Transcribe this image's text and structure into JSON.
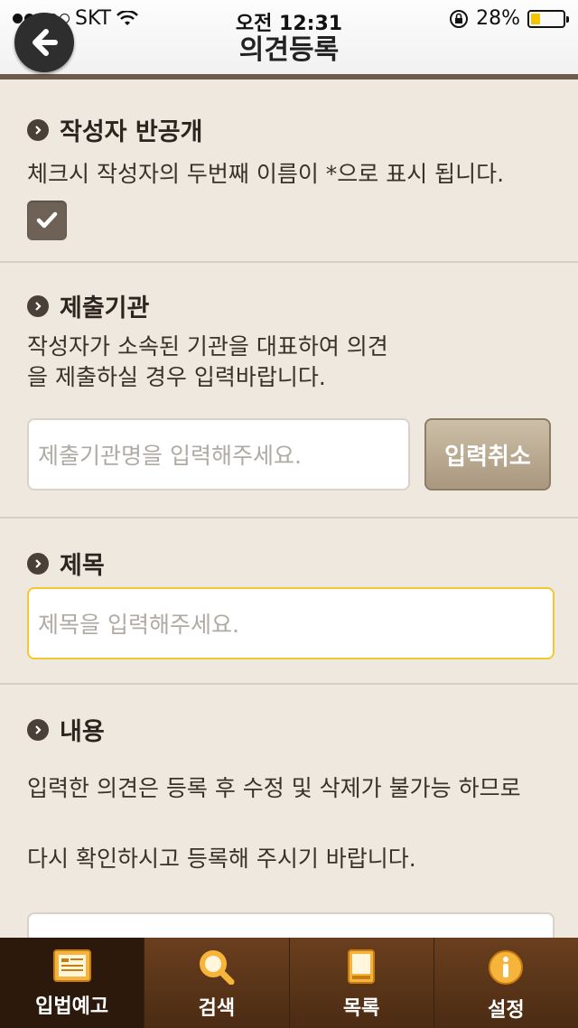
{
  "status_bar": {
    "carrier": "SKT",
    "time": "오전 12:31",
    "battery_percent": "28%",
    "battery_level": 0.28
  },
  "nav": {
    "title": "의견등록",
    "back_icon": "back-arrow-icon"
  },
  "sections": {
    "author_partial": {
      "title": "작성자 반공개",
      "description": "체크시 작성자의 두번째 이름이 *으로 표시 됩니다.",
      "checked": true
    },
    "organization": {
      "title": "제출기관",
      "description_line1": "작성자가 소속된 기관을 대표하여 의견",
      "description_line2": "을 제출하실 경우 입력바랍니다.",
      "input_placeholder": "제출기관명을 입력해주세요.",
      "cancel_label": "입력취소"
    },
    "subject": {
      "title": "제목",
      "input_placeholder": "제목을 입력해주세요."
    },
    "content": {
      "title": "내용",
      "notice_line1": "입력한 의견은 등록 후 수정 및 삭제가 불가능 하므로",
      "notice_line2": "다시 확인하시고 등록해 주시기 바랍니다."
    }
  },
  "tabbar": {
    "tabs": [
      {
        "label": "입법예고",
        "icon": "notice-board-icon",
        "active": true
      },
      {
        "label": "검색",
        "icon": "search-icon",
        "active": false
      },
      {
        "label": "목록",
        "icon": "book-list-icon",
        "active": false
      },
      {
        "label": "설정",
        "icon": "info-settings-icon",
        "active": false
      }
    ]
  },
  "colors": {
    "background": "#efe8df",
    "tabbar": "#5a3418",
    "accent_focus": "#f2c830",
    "cancel_button": "#b8a68c"
  }
}
